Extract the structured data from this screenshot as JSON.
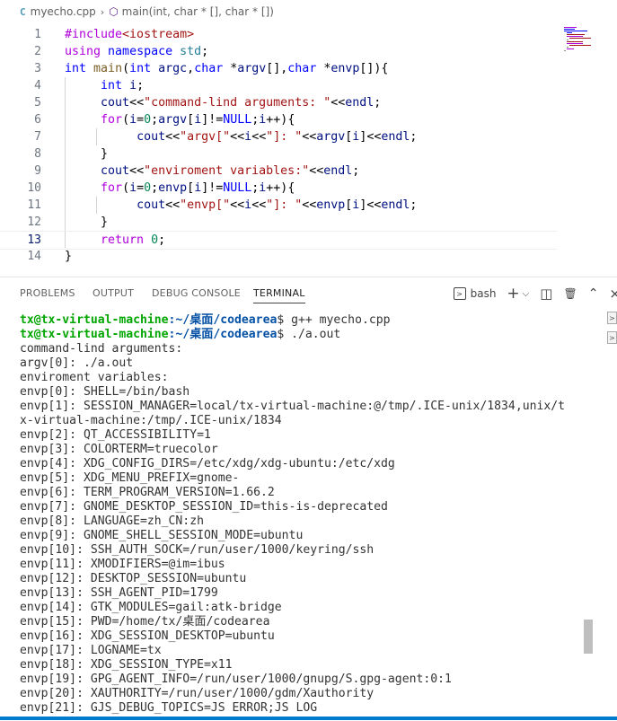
{
  "breadcrumb": {
    "file_icon": "C",
    "file": "myecho.cpp",
    "separator": "›",
    "symbol_icon": "⬡",
    "symbol": "main(int, char * [], char * [])"
  },
  "editor": {
    "active_line": 13,
    "lines": [
      {
        "n": "1"
      },
      {
        "n": "2"
      },
      {
        "n": "3"
      },
      {
        "n": "4"
      },
      {
        "n": "5"
      },
      {
        "n": "6"
      },
      {
        "n": "7"
      },
      {
        "n": "8"
      },
      {
        "n": "9"
      },
      {
        "n": "10"
      },
      {
        "n": "11"
      },
      {
        "n": "12"
      },
      {
        "n": "13"
      },
      {
        "n": "14"
      }
    ],
    "tokens": {
      "l1_pp": "#include",
      "l1_hdr": "<iostream>",
      "l2_using": "using",
      "l2_ns": "namespace",
      "l2_std": "std",
      "l2_end": ";",
      "l3_int": "int",
      "l3_main": "main",
      "l3_p1": "(",
      "l3_int2": "int",
      "l3_argc": "argc",
      "l3_c1": ",",
      "l3_char": "char",
      "l3_star": " *",
      "l3_argv": "argv",
      "l3_br": "[],",
      "l3_char2": "char",
      "l3_star2": " *",
      "l3_envp": "envp",
      "l3_end": "[]){",
      "l4_int": "int",
      "l4_i": "i",
      "l4_end": ";",
      "l5_cout": "cout",
      "l5_op": "<<",
      "l5_str": "\"command-lind arguments: \"",
      "l5_op2": "<<",
      "l5_endl": "endl",
      "l5_end": ";",
      "l6_for": "for",
      "l6_p": "(",
      "l6_i": "i",
      "l6_eq": "=",
      "l6_zero": "0",
      "l6_sc": ";",
      "l6_argv": "argv",
      "l6_b1": "[",
      "l6_i2": "i",
      "l6_b2": "]!=",
      "l6_null": "NULL",
      "l6_sc2": ";",
      "l6_i3": "i",
      "l6_end": "++){",
      "l7_cout": "cout",
      "l7_op": "<<",
      "l7_s1": "\"argv[\"",
      "l7_op2": "<<",
      "l7_i": "i",
      "l7_op3": "<<",
      "l7_s2": "\"]: \"",
      "l7_op4": "<<",
      "l7_argv": "argv",
      "l7_b1": "[",
      "l7_i2": "i",
      "l7_b2": "]",
      "l7_op5": "<<",
      "l7_endl": "endl",
      "l7_end": ";",
      "l8_close": "}",
      "l9_cout": "cout",
      "l9_op": "<<",
      "l9_str": "\"enviroment variables:\"",
      "l9_op2": "<<",
      "l9_endl": "endl",
      "l9_end": ";",
      "l10_for": "for",
      "l10_p": "(",
      "l10_i": "i",
      "l10_eq": "=",
      "l10_zero": "0",
      "l10_sc": ";",
      "l10_envp": "envp",
      "l10_b1": "[",
      "l10_i2": "i",
      "l10_b2": "]!=",
      "l10_null": "NULL",
      "l10_sc2": ";",
      "l10_i3": "i",
      "l10_end": "++){",
      "l11_cout": "cout",
      "l11_op": "<<",
      "l11_s1": "\"envp[\"",
      "l11_op2": "<<",
      "l11_i": "i",
      "l11_op3": "<<",
      "l11_s2": "\"]: \"",
      "l11_op4": "<<",
      "l11_envp": "envp",
      "l11_b1": "[",
      "l11_i2": "i",
      "l11_b2": "]",
      "l11_op5": "<<",
      "l11_endl": "endl",
      "l11_end": ";",
      "l12_close": "}",
      "l13_return": "return",
      "l13_zero": "0",
      "l13_end": ";",
      "l14_close": "}"
    }
  },
  "panel": {
    "tabs": [
      "PROBLEMS",
      "OUTPUT",
      "DEBUG CONSOLE",
      "TERMINAL"
    ],
    "active_tab": "TERMINAL",
    "shell_label": "bash",
    "shell_icon": ">",
    "add_icon": "+",
    "dropdown_icon": "⌵",
    "split_icon": "◫",
    "trash_icon": "🗑",
    "maximize_icon": "⌃",
    "close_icon": "×"
  },
  "terminal": {
    "prompt_user": "tx@tx-virtual-machine",
    "prompt_path": ":~/桌面/codearea",
    "prompt_symbol": "$",
    "commands": [
      " g++ myecho.cpp",
      " ./a.out"
    ],
    "output": [
      "command-lind arguments:",
      "argv[0]: ./a.out",
      "enviroment variables:",
      "envp[0]: SHELL=/bin/bash",
      "envp[1]: SESSION_MANAGER=local/tx-virtual-machine:@/tmp/.ICE-unix/1834,unix/t",
      "x-virtual-machine:/tmp/.ICE-unix/1834",
      "envp[2]: QT_ACCESSIBILITY=1",
      "envp[3]: COLORTERM=truecolor",
      "envp[4]: XDG_CONFIG_DIRS=/etc/xdg/xdg-ubuntu:/etc/xdg",
      "envp[5]: XDG_MENU_PREFIX=gnome-",
      "envp[6]: TERM_PROGRAM_VERSION=1.66.2",
      "envp[7]: GNOME_DESKTOP_SESSION_ID=this-is-deprecated",
      "envp[8]: LANGUAGE=zh_CN:zh",
      "envp[9]: GNOME_SHELL_SESSION_MODE=ubuntu",
      "envp[10]: SSH_AUTH_SOCK=/run/user/1000/keyring/ssh",
      "envp[11]: XMODIFIERS=@im=ibus",
      "envp[12]: DESKTOP_SESSION=ubuntu",
      "envp[13]: SSH_AGENT_PID=1799",
      "envp[14]: GTK_MODULES=gail:atk-bridge",
      "envp[15]: PWD=/home/tx/桌面/codearea",
      "envp[16]: XDG_SESSION_DESKTOP=ubuntu",
      "envp[17]: LOGNAME=tx",
      "envp[18]: XDG_SESSION_TYPE=x11",
      "envp[19]: GPG_AGENT_INFO=/run/user/1000/gnupg/S.gpg-agent:0:1",
      "envp[20]: XAUTHORITY=/run/user/1000/gdm/Xauthority",
      "envp[21]: GJS_DEBUG_TOPICS=JS ERROR;JS LOG"
    ],
    "side_tab_icon": ">"
  }
}
